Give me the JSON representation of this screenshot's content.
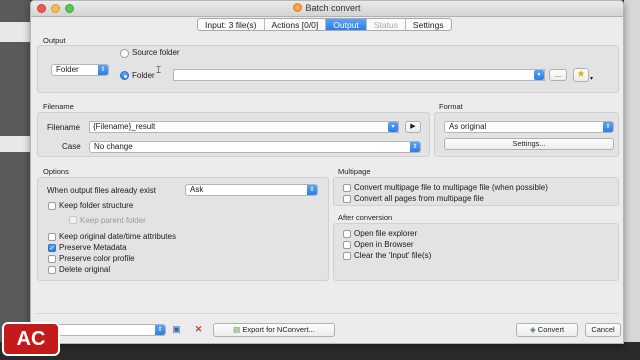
{
  "window": {
    "title": "Batch convert"
  },
  "tabs": [
    {
      "label": "Input: 3 file(s)",
      "state": "normal"
    },
    {
      "label": "Actions [0/0]",
      "state": "normal"
    },
    {
      "label": "Output",
      "state": "active"
    },
    {
      "label": "Status",
      "state": "disabled"
    },
    {
      "label": "Settings",
      "state": "normal"
    }
  ],
  "output": {
    "section_label": "Output",
    "mode_select": "Folder",
    "source_folder_label": "Source folder",
    "folder_label": "Folder",
    "folder_path": "",
    "browse_label": "...",
    "source_folder_selected": false,
    "folder_selected": true
  },
  "filename": {
    "section_label": "Filename",
    "filename_label": "Filename",
    "filename_value": "{Filename}_result",
    "case_label": "Case",
    "case_value": "No change"
  },
  "format": {
    "section_label": "Format",
    "format_value": "As original",
    "settings_label": "Settings..."
  },
  "options": {
    "section_label": "Options",
    "exists_label": "When output files already exist",
    "exists_value": "Ask",
    "keep_folder_structure": {
      "label": "Keep folder structure",
      "checked": false
    },
    "keep_parent_folder": {
      "label": "Keep parent folder",
      "checked": false,
      "disabled": true
    },
    "keep_date_time": {
      "label": "Keep original date/time attributes",
      "checked": false
    },
    "preserve_metadata": {
      "label": "Preserve Metadata",
      "checked": true
    },
    "preserve_color_profile": {
      "label": "Preserve color profile",
      "checked": false
    },
    "delete_original": {
      "label": "Delete original",
      "checked": false
    }
  },
  "multipage": {
    "section_label": "Multipage",
    "convert_multipage": {
      "label": "Convert multipage file to multipage file (when possible)",
      "checked": false
    },
    "convert_all_pages": {
      "label": "Convert all pages from multipage file",
      "checked": false
    }
  },
  "after_conversion": {
    "section_label": "After conversion",
    "open_explorer": {
      "label": "Open file explorer",
      "checked": false
    },
    "open_browser": {
      "label": "Open in Browser",
      "checked": false
    },
    "clear_input": {
      "label": "Clear the 'Input' file(s)",
      "checked": false
    }
  },
  "footer": {
    "preset_value": "",
    "export_label": "Export for NConvert...",
    "convert_label": "Convert",
    "cancel_label": "Cancel"
  },
  "overlay": {
    "logo_text": "AC"
  },
  "colors": {
    "accent": "#2d7de6",
    "window_bg": "#ececec",
    "group_bg": "#e3e3e3",
    "logo_red": "#c41a1a"
  }
}
